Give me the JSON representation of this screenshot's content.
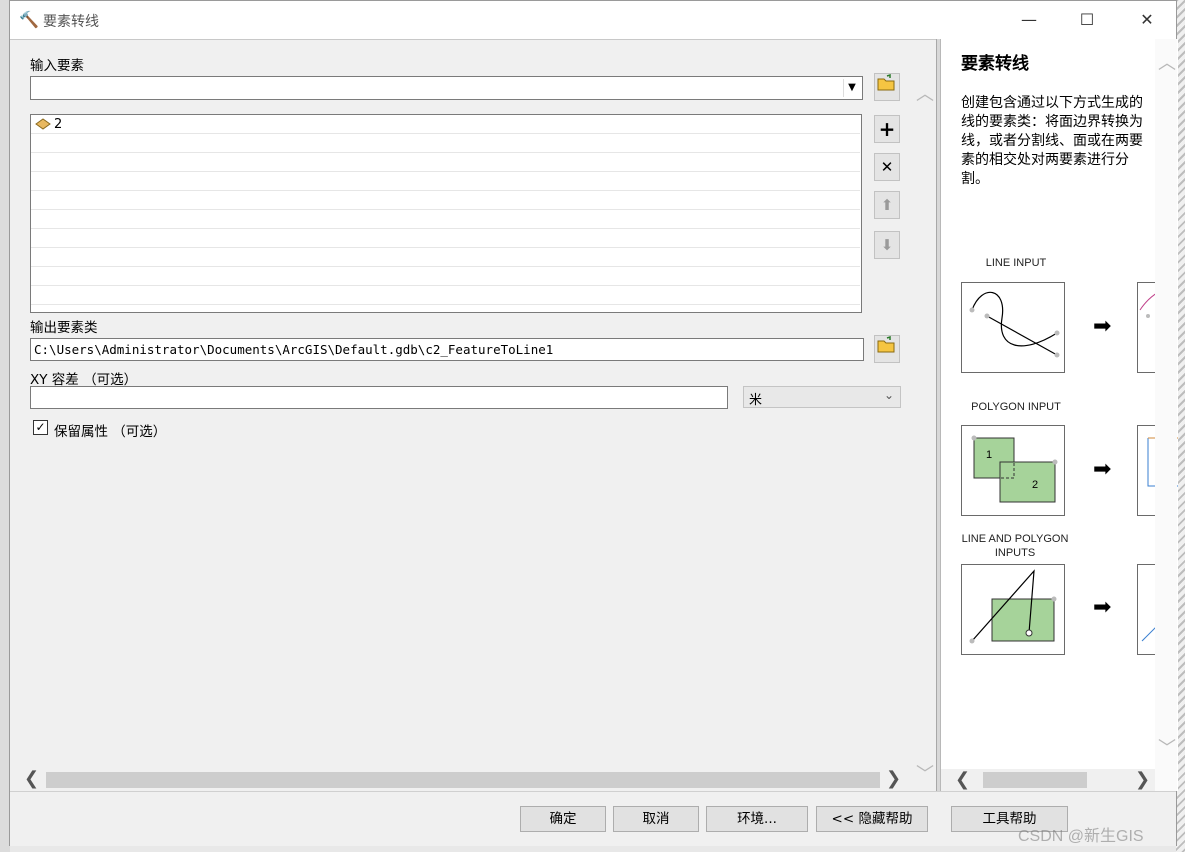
{
  "window": {
    "title": "要素转线",
    "controls": [
      "—",
      "☐",
      "✕"
    ]
  },
  "form": {
    "input_features_label": "输入要素",
    "input_features_value": "",
    "feature_list": [
      "2"
    ],
    "output_label": "输出要素类",
    "output_value": "C:\\Users\\Administrator\\Documents\\ArcGIS\\Default.gdb\\c2_FeatureToLine1",
    "xy_tolerance_label": "XY 容差 （可选）",
    "xy_tolerance_value": "",
    "unit_value": "米",
    "preserve_attributes_label": "保留属性 （可选）",
    "preserve_attributes_checked": true
  },
  "help": {
    "title": "要素转线",
    "description": "创建包含通过以下方式生成的线的要素类：将面边界转换为线，或者分割线、面或在两要素的相交处对两要素进行分割。",
    "diagrams": [
      {
        "label": "LINE INPUT"
      },
      {
        "label": "POLYGON INPUT",
        "polygon_labels": [
          "1",
          "2"
        ]
      },
      {
        "label": "LINE AND POLYGON INPUTS"
      }
    ]
  },
  "buttons": {
    "ok": "确定",
    "cancel": "取消",
    "environments": "环境...",
    "hide_help": "<< 隐藏帮助",
    "tool_help": "工具帮助"
  },
  "watermark": "CSDN @新生GIS",
  "colors": {
    "polygon_fill": "#a6d39a",
    "accent": "#0078d7"
  }
}
